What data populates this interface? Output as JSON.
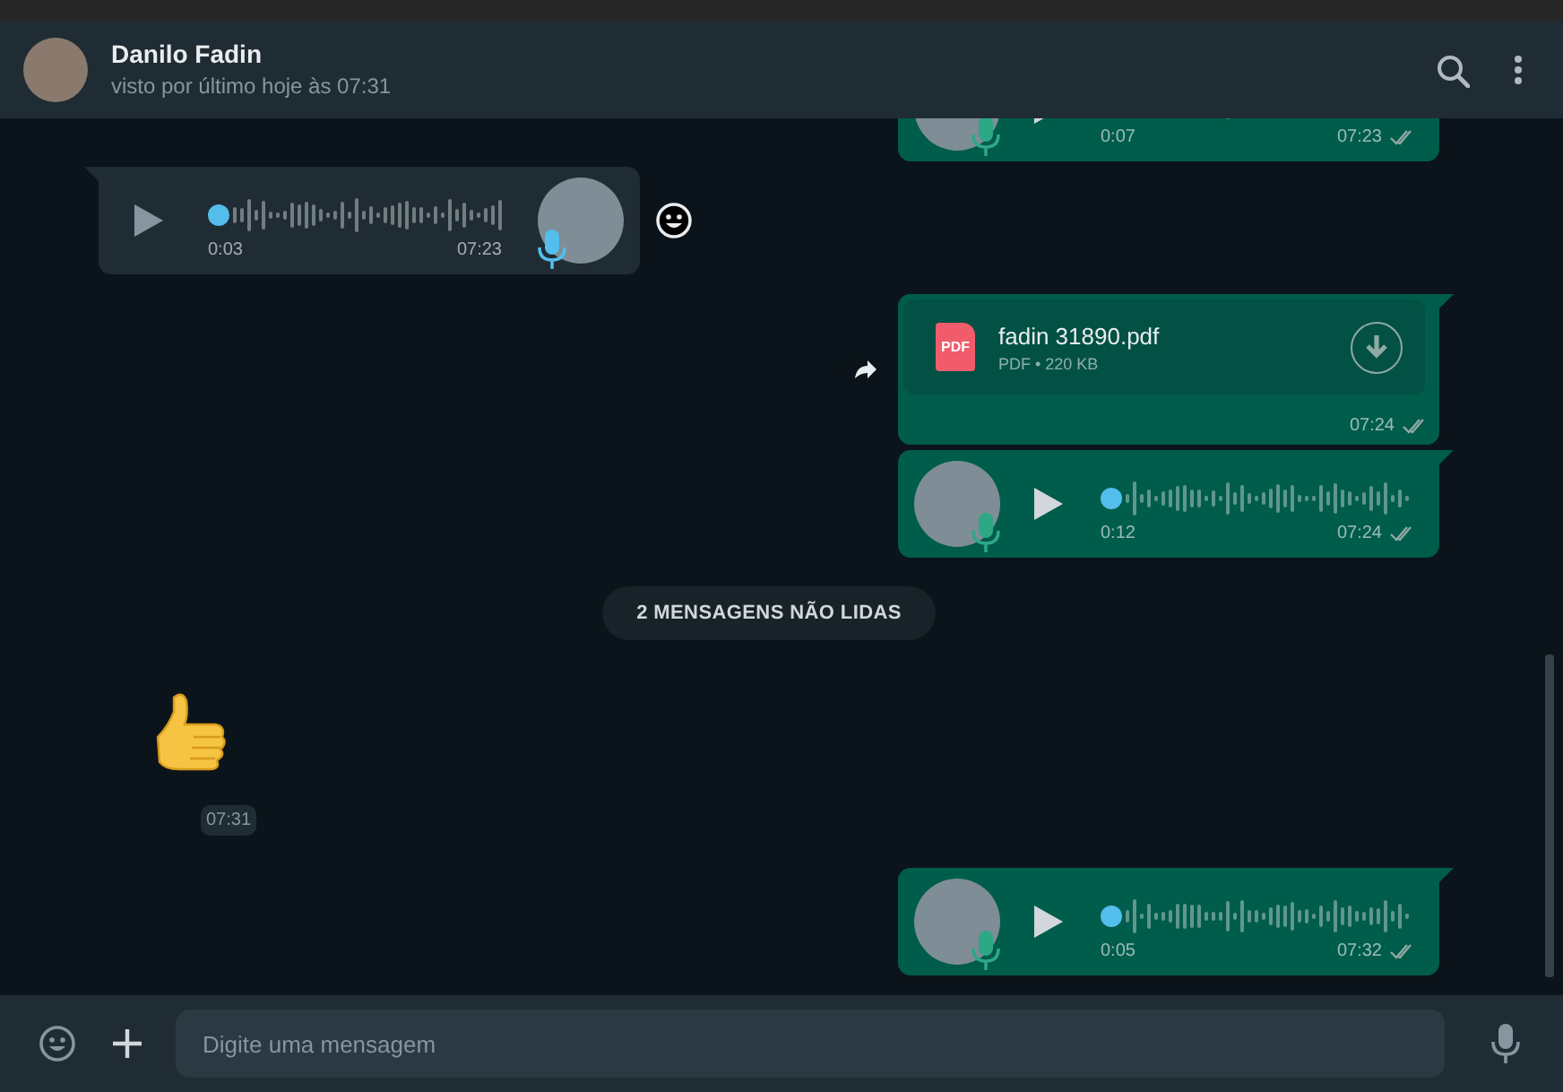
{
  "header": {
    "name": "Danilo Fadin",
    "status": "visto por último hoje às 07:31"
  },
  "messages": [
    {
      "kind": "voice",
      "outgoing": true,
      "duration": "0:07",
      "time": "07:23",
      "read": false
    },
    {
      "kind": "voice",
      "outgoing": false,
      "duration": "0:03",
      "time": "07:23",
      "level": 0,
      "reaction": true
    },
    {
      "kind": "document",
      "outgoing": true,
      "file_icon_label": "PDF",
      "file_name": "fadin 31890.pdf",
      "file_meta": "PDF • 220 KB",
      "time": "07:24",
      "read": false,
      "forward": true
    },
    {
      "kind": "voice",
      "outgoing": true,
      "duration": "0:12",
      "time": "07:24",
      "read": false,
      "level": 0
    },
    {
      "kind": "banner",
      "text": "2 MENSAGENS NÃO LIDAS"
    },
    {
      "kind": "emoji",
      "outgoing": false,
      "time": "07:31"
    },
    {
      "kind": "voice",
      "outgoing": true,
      "duration": "0:05",
      "time": "07:32",
      "read": false,
      "level": 0
    }
  ],
  "compose": {
    "placeholder": "Digite uma mensagem"
  }
}
